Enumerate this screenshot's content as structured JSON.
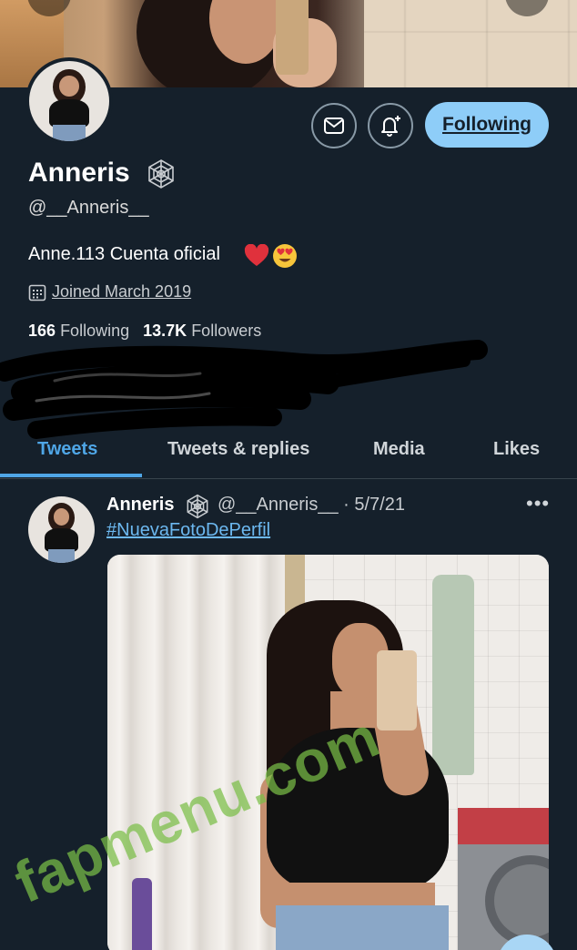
{
  "profile": {
    "display_name": "Anneris",
    "handle": "@__Anneris__",
    "bio": "Anne.113 Cuenta oficial",
    "bio_emojis": [
      "red-heart",
      "heart-eyes-face"
    ],
    "joined": "Joined March 2019",
    "following_count": "166",
    "following_label": "Following",
    "followers_count": "13.7K",
    "followers_label": "Followers",
    "badge_icon": "spiderweb-icon"
  },
  "actions": {
    "message_icon": "envelope-icon",
    "notify_icon": "bell-plus-icon",
    "follow_button_label": "Following"
  },
  "tabs": [
    {
      "label": "Tweets",
      "active": true
    },
    {
      "label": "Tweets & replies",
      "active": false
    },
    {
      "label": "Media",
      "active": false
    },
    {
      "label": "Likes",
      "active": false
    }
  ],
  "tweet": {
    "author_name": "Anneris",
    "author_handle_date": "@__Anneris__ · 5/7/21",
    "more_label": "•••",
    "hashtag": "#NuevaFotoDePerfil"
  },
  "watermark": "fapmenu.com",
  "colors": {
    "background": "#15202b",
    "accent": "#4fa6e6",
    "follow_button": "#8ecdf8",
    "divider": "#38444d",
    "watermark": "#7abe46"
  }
}
